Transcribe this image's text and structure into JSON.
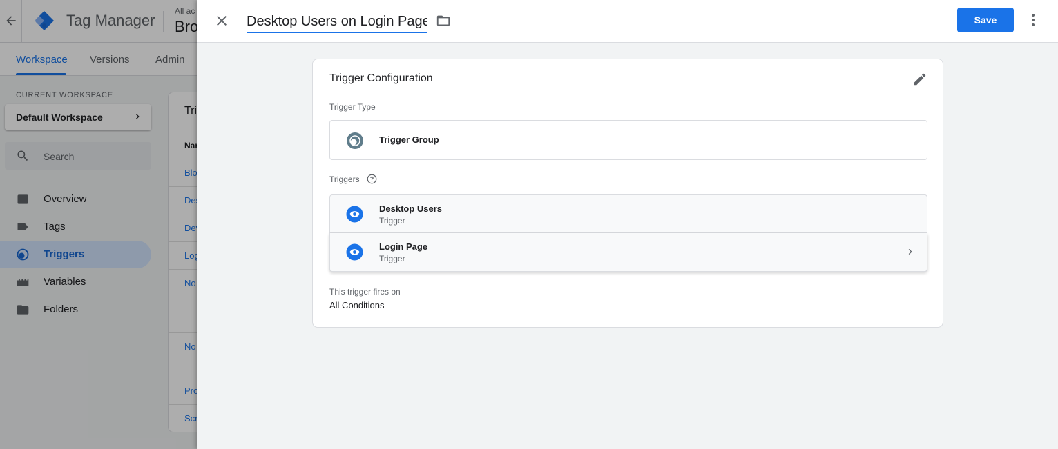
{
  "app": {
    "name": "Tag Manager",
    "account_small": "All ac",
    "account_big": "Bro"
  },
  "nav": {
    "tabs": [
      {
        "label": "Workspace",
        "active": true
      },
      {
        "label": "Versions",
        "active": false
      },
      {
        "label": "Admin",
        "active": false
      }
    ]
  },
  "sidebar": {
    "workspace_label": "CURRENT WORKSPACE",
    "workspace_name": "Default Workspace",
    "search_placeholder": "Search",
    "items": [
      {
        "label": "Overview",
        "icon": "overview-icon",
        "active": false
      },
      {
        "label": "Tags",
        "icon": "tag-icon",
        "active": false
      },
      {
        "label": "Triggers",
        "icon": "trigger-icon",
        "active": true
      },
      {
        "label": "Variables",
        "icon": "variables-icon",
        "active": false
      },
      {
        "label": "Folders",
        "icon": "folder-icon",
        "active": false
      }
    ]
  },
  "list": {
    "title": "Tri",
    "header": "Nar",
    "rows": [
      "Blo",
      "Des",
      "Dev",
      "Log",
      "No",
      "No",
      "Pro",
      "Scr"
    ]
  },
  "sheet": {
    "title_value": "Desktop Users on Login Page",
    "save_label": "Save",
    "card_title": "Trigger Configuration",
    "trigger_type_label": "Trigger Type",
    "trigger_type_value": "Trigger Group",
    "triggers_label": "Triggers",
    "triggers": [
      {
        "name": "Desktop Users",
        "type": "Trigger"
      },
      {
        "name": "Login Page",
        "type": "Trigger"
      }
    ],
    "fires_on_label": "This trigger fires on",
    "fires_on_value": "All Conditions"
  },
  "colors": {
    "accent": "#1a73e8",
    "trigger_icon": "#1a73e8",
    "trigger_group_icon": "#607d8b"
  }
}
